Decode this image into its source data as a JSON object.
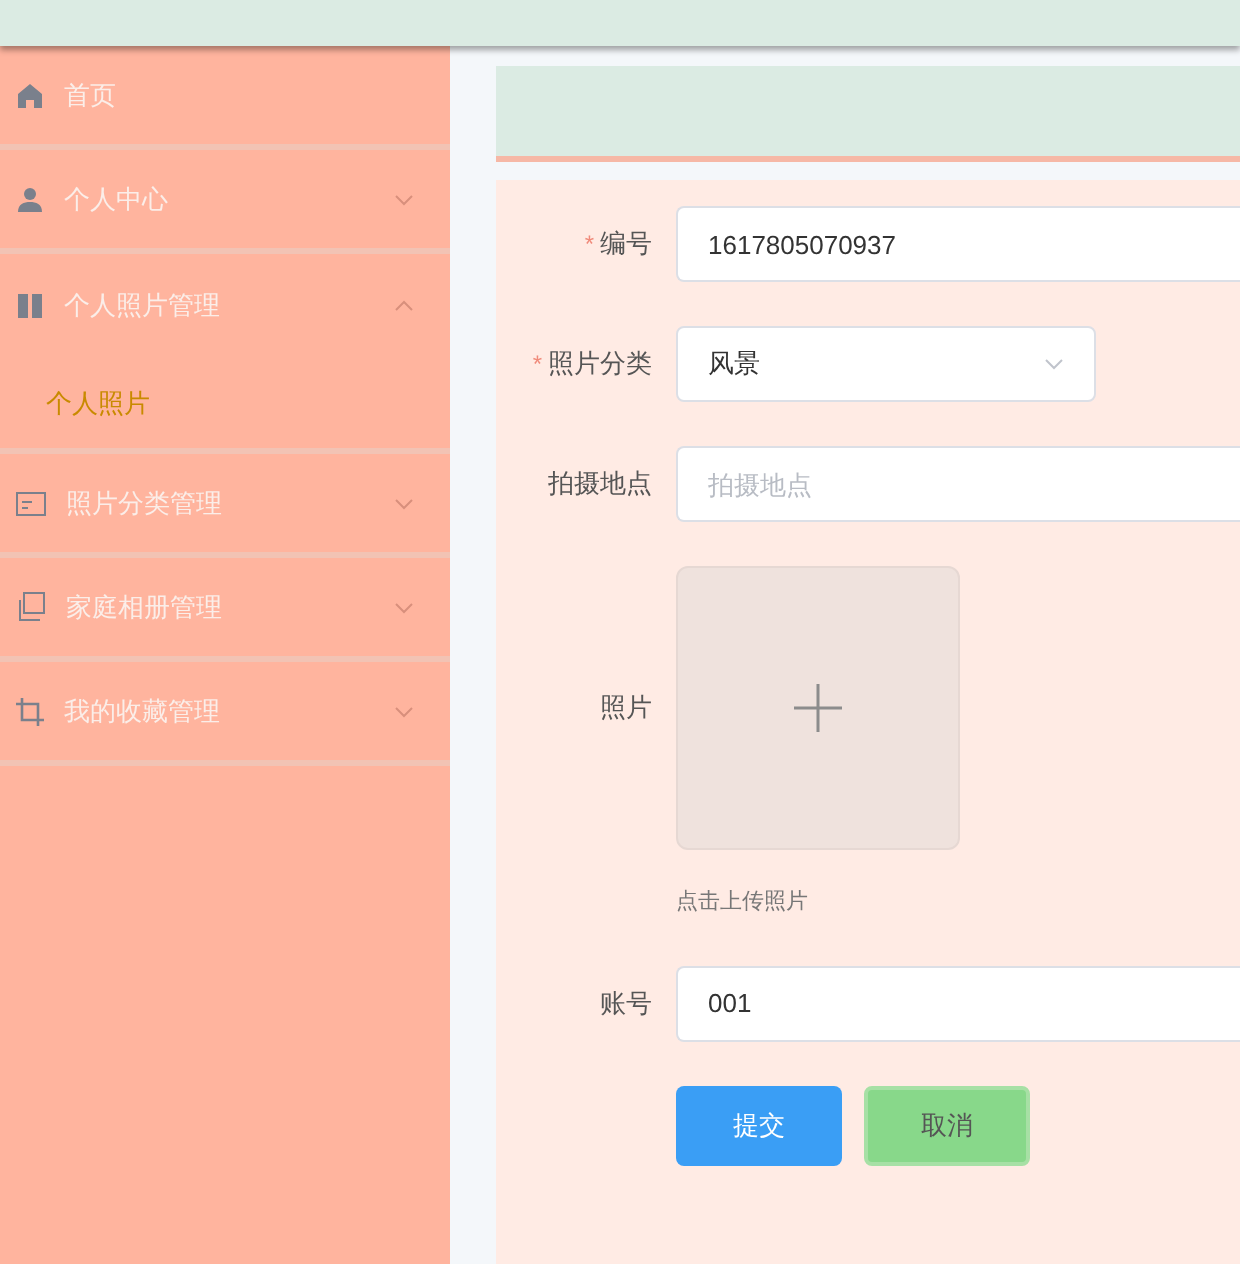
{
  "sidebar": {
    "items": [
      {
        "label": "首页"
      },
      {
        "label": "个人中心",
        "expanded": false
      },
      {
        "label": "个人照片管理",
        "expanded": true,
        "children": [
          {
            "label": "个人照片",
            "selected": true
          }
        ]
      },
      {
        "label": "照片分类管理",
        "expanded": false
      },
      {
        "label": "家庭相册管理",
        "expanded": false
      },
      {
        "label": "我的收藏管理",
        "expanded": false
      }
    ]
  },
  "form": {
    "fields": [
      {
        "kind": "text",
        "required_mark": "*",
        "label": "编号",
        "value": "1617805070937"
      },
      {
        "kind": "select",
        "required_mark": "*",
        "label": "照片分类",
        "value": "风景"
      },
      {
        "kind": "text",
        "label": "拍摄地点",
        "placeholder": "拍摄地点"
      },
      {
        "kind": "upload",
        "label": "照片",
        "hint": "点击上传照片"
      },
      {
        "kind": "text",
        "label": "账号",
        "value": "001"
      }
    ],
    "buttons": [
      {
        "kind": "primary",
        "label": "提交"
      },
      {
        "kind": "cancel",
        "label": "取消"
      }
    ]
  }
}
